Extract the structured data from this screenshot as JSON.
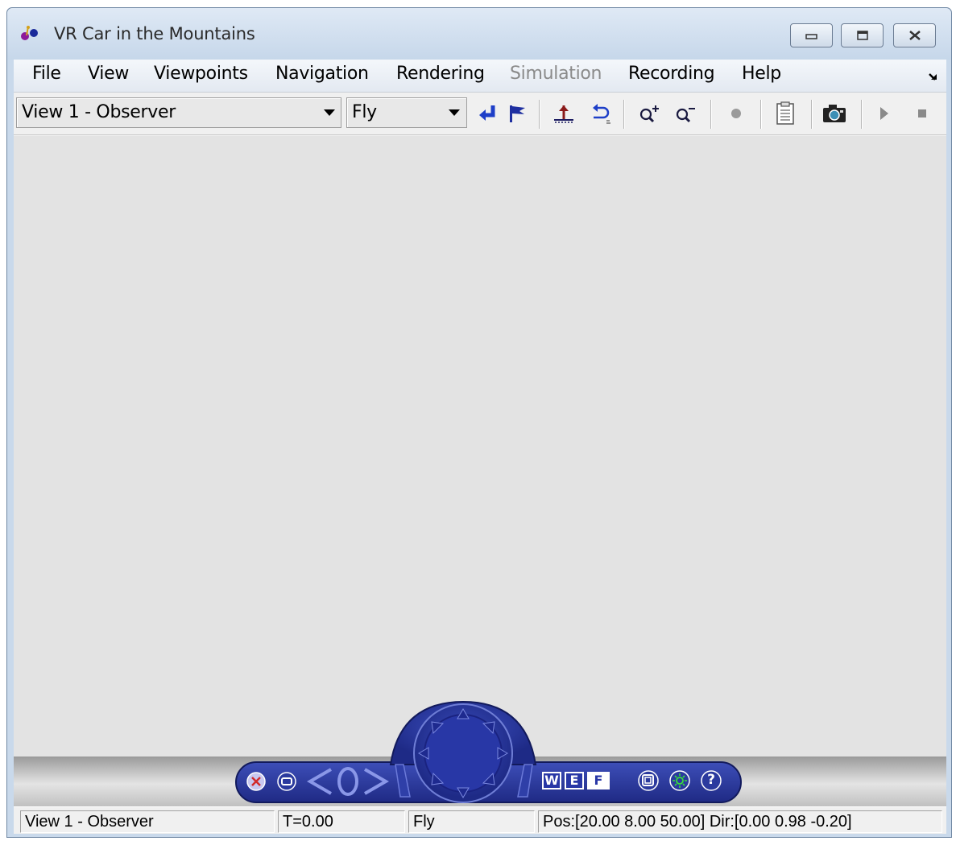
{
  "window": {
    "title": "VR Car in the Mountains",
    "icon": "vr-app-icon"
  },
  "title_buttons": {
    "minimize": "minimize-icon",
    "maximize": "maximize-icon",
    "close": "close-icon"
  },
  "menubar": {
    "items": [
      {
        "label": "File",
        "enabled": true
      },
      {
        "label": "View",
        "enabled": true
      },
      {
        "label": "Viewpoints",
        "enabled": true
      },
      {
        "label": "Navigation",
        "enabled": true
      },
      {
        "label": "Rendering",
        "enabled": true
      },
      {
        "label": "Simulation",
        "enabled": false
      },
      {
        "label": "Recording",
        "enabled": true
      },
      {
        "label": "Help",
        "enabled": true
      }
    ]
  },
  "toolbar": {
    "viewpoint_select": "View 1 - Observer",
    "navigation_mode_select": "Fly",
    "buttons": [
      "return-to-viewpoint-icon",
      "create-viewpoint-icon",
      "straighten-up-icon",
      "undo-move-icon",
      "zoom-in-icon",
      "zoom-out-icon",
      "record-icon",
      "capture-parameters-icon",
      "snapshot-camera-icon",
      "play-icon",
      "stop-icon"
    ]
  },
  "navigation_panel": {
    "labels": {
      "walk": "W",
      "examine": "E",
      "fly": "F",
      "help": "?"
    },
    "accent": "#2b3a9e"
  },
  "statusbar": {
    "viewpoint": "View 1 - Observer",
    "time": "T=0.00",
    "mode": "Fly",
    "position": "Pos:[20.00 8.00 50.00] Dir:[0.00 0.98 -0.20]"
  }
}
